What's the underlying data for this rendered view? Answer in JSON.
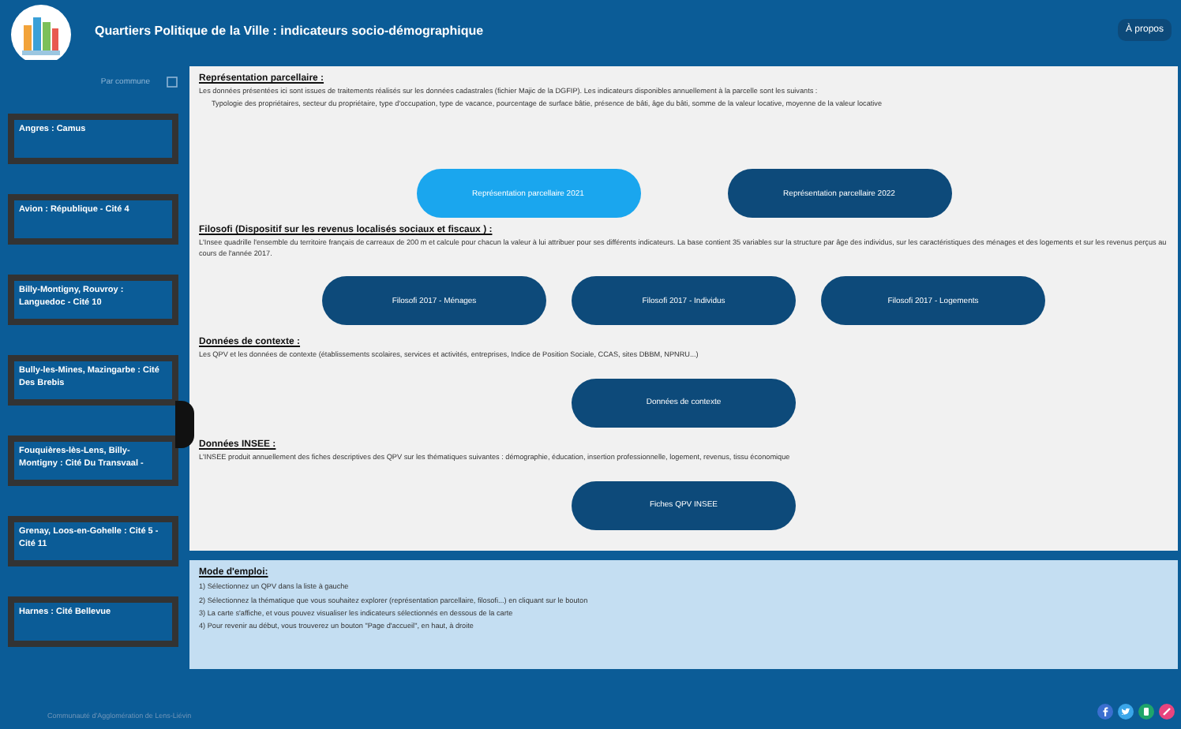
{
  "header": {
    "title": "Quartiers Politique de la Ville : indicateurs socio-démographique",
    "about_button": "À propos"
  },
  "sidebar": {
    "filter_link": "Par commune",
    "items": [
      {
        "label": "Angres : Camus"
      },
      {
        "label": "Avion : République - Cité 4"
      },
      {
        "label": "Billy-Montigny, Rouvroy : Languedoc - Cité 10"
      },
      {
        "label": "Bully-les-Mines, Mazingarbe : Cité Des Brebis"
      },
      {
        "label": "Fouquières-lès-Lens, Billy-Montigny : Cité Du Transvaal -"
      },
      {
        "label": "Grenay, Loos-en-Gohelle : Cité 5 - Cité 11"
      },
      {
        "label": "Harnes : Cité Bellevue"
      }
    ]
  },
  "sections": [
    {
      "title": "Représentation parcellaire :",
      "paragraphs": [
        "Les données présentées ici sont issues de traitements réalisés sur les données cadastrales (fichier Majic de la DGFIP). Les indicateurs disponibles annuellement à la parcelle sont les suivants :",
        "Typologie des propriétaires, secteur du propriétaire, type d'occupation, type de vacance, pourcentage de surface bâtie, présence de bâti, âge du bâti, somme de la valeur locative, moyenne de la valeur locative"
      ],
      "buttons": [
        {
          "label": "Représentation parcellaire 2021",
          "selected": true
        },
        {
          "label": "Représentation parcellaire 2022",
          "selected": false
        }
      ]
    },
    {
      "title": "Filosofi (Dispositif sur les revenus localisés sociaux et fiscaux ) :",
      "paragraphs": [
        "L'Insee quadrille l'ensemble du territoire français de carreaux de 200 m et calcule pour chacun la valeur à lui attribuer pour ses différents indicateurs. La base contient 35 variables sur la structure par âge des individus, sur les caractéristiques des ménages et des logements et sur les revenus perçus au cours de l'année 2017."
      ],
      "buttons": [
        {
          "label": "Filosofi 2017 - Ménages",
          "selected": false
        },
        {
          "label": "Filosofi 2017 - Individus",
          "selected": false
        },
        {
          "label": "Filosofi 2017 - Logements",
          "selected": false
        }
      ]
    },
    {
      "title": "Données de contexte :",
      "paragraphs": [
        "Les QPV et les données de contexte (établissements scolaires, services et activités, entreprises, Indice de Position Sociale, CCAS, sites DBBM, NPNRU...)"
      ],
      "buttons": [
        {
          "label": "Données de contexte",
          "selected": false
        }
      ]
    },
    {
      "title": "Données INSEE :",
      "paragraphs": [
        "L'INSEE produit annuellement des fiches descriptives des QPV sur les thématiques suivantes : démographie, éducation, insertion professionnelle, logement, revenus, tissu économique"
      ],
      "buttons": [
        {
          "label": "Fiches QPV INSEE",
          "selected": false
        }
      ]
    }
  ],
  "instructions": {
    "title": "Mode d'emploi:",
    "steps": [
      "1) Sélectionnez un QPV dans la liste à gauche",
      "2) Sélectionnez la thématique que vous souhaitez explorer (représentation parcellaire, filosofi...) en cliquant sur le bouton",
      "3) La carte s'affiche, et vous pouvez visualiser les indicateurs sélectionnés en dessous de la carte",
      "4) Pour revenir au début, vous trouverez un bouton \"Page d'accueil\", en haut, à droite"
    ]
  },
  "footer": {
    "credit": "Communauté d'Agglomération de Lens-Liévin"
  }
}
